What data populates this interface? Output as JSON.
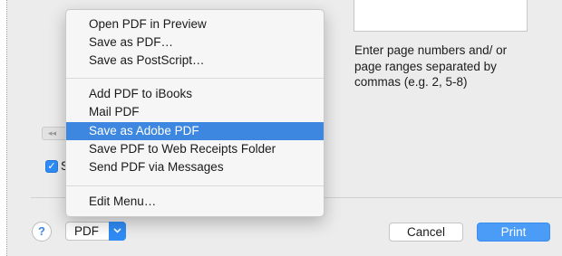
{
  "pages_hint": "Enter page numbers and/ or page ranges separated by commas (e.g. 2, 5-8)",
  "checkbox_label": "S",
  "checkbox_mark": "✓",
  "left_stub_glyph": "◂◂",
  "menu": {
    "items": [
      {
        "label": "Open PDF in Preview",
        "selected": false
      },
      {
        "label": "Save as PDF…",
        "selected": false
      },
      {
        "label": "Save as PostScript…",
        "selected": false
      },
      {
        "label": "Add PDF to iBooks",
        "selected": false
      },
      {
        "label": "Mail PDF",
        "selected": false
      },
      {
        "label": "Save as Adobe PDF",
        "selected": true
      },
      {
        "label": "Save PDF to Web Receipts Folder",
        "selected": false
      },
      {
        "label": "Send PDF via Messages",
        "selected": false
      },
      {
        "label": "Edit Menu…",
        "selected": false
      }
    ]
  },
  "footer": {
    "help_label": "?",
    "pdf_label": "PDF",
    "cancel_label": "Cancel",
    "print_label": "Print"
  },
  "colors": {
    "accent": "#2f8cf5",
    "selection": "#3d87e0",
    "print_button": "#4a9cf7"
  }
}
